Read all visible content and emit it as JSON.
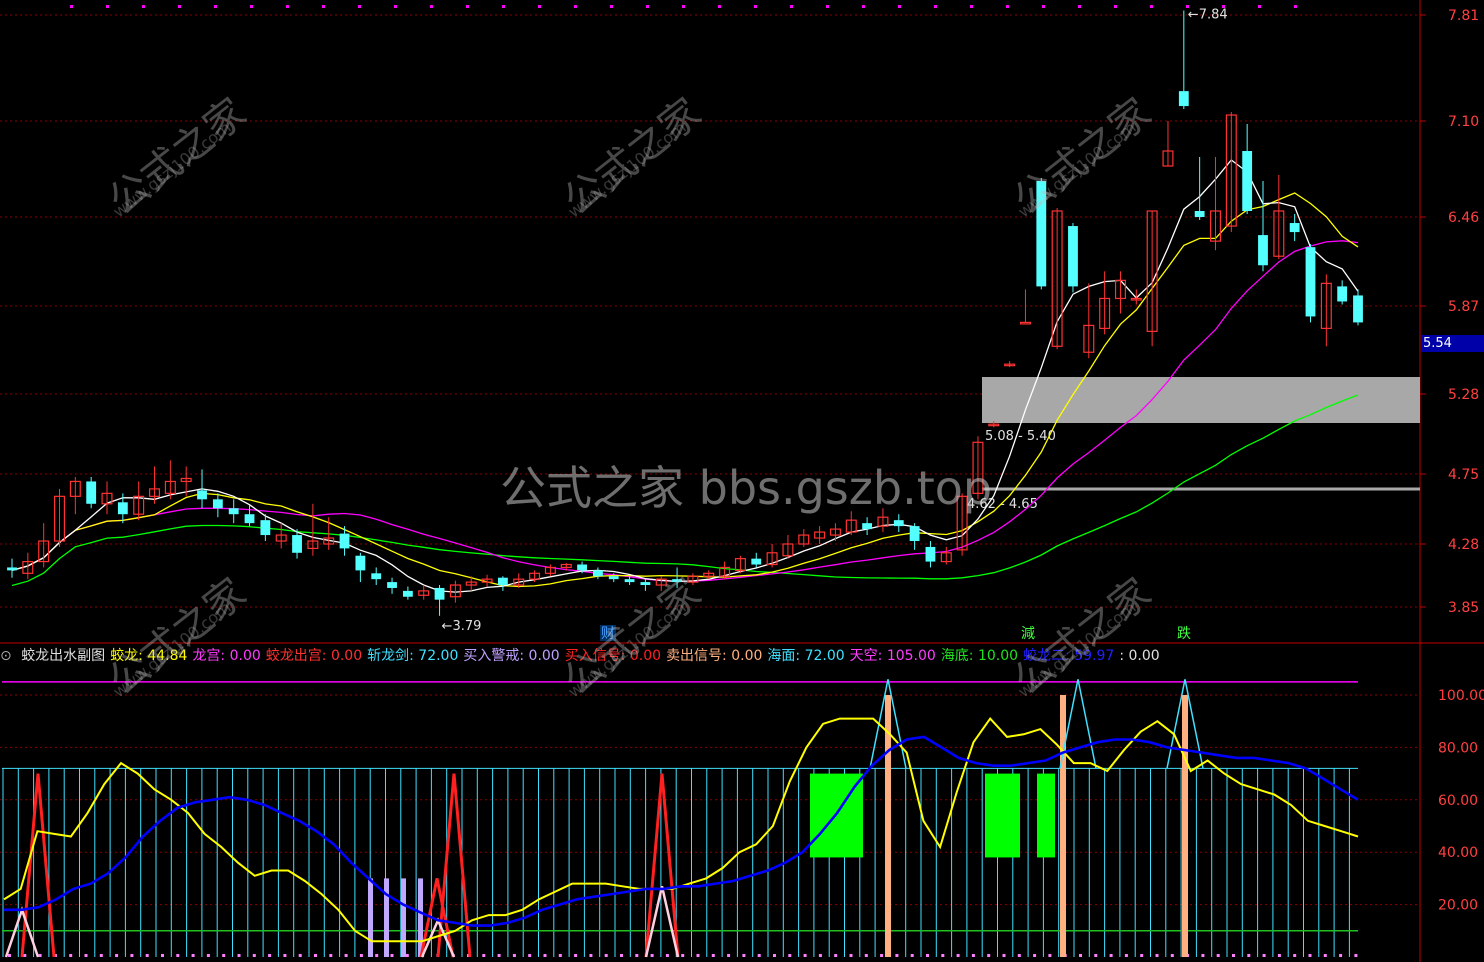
{
  "price_axis": {
    "ticks": [
      "7.81",
      "7.10",
      "6.46",
      "5.87",
      "5.28",
      "4.75",
      "4.28",
      "3.85"
    ],
    "current_price": "5.54"
  },
  "indicator_axis": {
    "ticks": [
      "100.00",
      "80.00",
      "60.00",
      "40.00",
      "20.00"
    ]
  },
  "annotations": {
    "high": "7.84",
    "low": "3.79",
    "zone_upper": "5.08 - 5.40",
    "zone_lower": "4.62 - 4.65",
    "markers": [
      "财",
      "減",
      "跌"
    ]
  },
  "indicator_legend": [
    {
      "name": "蛟龙出水副图",
      "value": "",
      "color": "#e0e0e0"
    },
    {
      "name": "蛟龙",
      "value": "44.84",
      "color": "#ffff00"
    },
    {
      "name": "龙宫",
      "value": "0.00",
      "color": "#ff3cff"
    },
    {
      "name": "蛟龙出宫",
      "value": "0.00",
      "color": "#ff3030"
    },
    {
      "name": "斩龙剑",
      "value": "72.00",
      "color": "#40e0ff"
    },
    {
      "name": "买入警戒",
      "value": "0.00",
      "color": "#c0a0ff"
    },
    {
      "name": "买入信号",
      "value": "0.00",
      "color": "#ff2020"
    },
    {
      "name": "卖出信号",
      "value": "0.00",
      "color": "#ffb080"
    },
    {
      "name": "海面",
      "value": "72.00",
      "color": "#40e0ff"
    },
    {
      "name": "天空",
      "value": "105.00",
      "color": "#ff3cff"
    },
    {
      "name": "海底",
      "value": "10.00",
      "color": "#20e020"
    },
    {
      "name": "蛟龙二",
      "value": "59.97",
      "color": "#2020ff"
    },
    {
      "name": "",
      "value": "0.00",
      "color": "#e0e0e0"
    }
  ],
  "watermarks": {
    "cn": "公式之家",
    "url": "www.gszj100.com",
    "main": "公式之家 bbs.gszb.top"
  },
  "colors": {
    "up": "#ff3232",
    "down": "#54ffff",
    "ma5": "#ffffff",
    "ma10": "#ffff00",
    "ma20": "#ff00ff",
    "ma60": "#00ff00",
    "grid": "#8b0000",
    "dragon": "#ffff00",
    "dragon2": "#0000ff",
    "sword": "#40e0ff",
    "sea_floor": "#20c020"
  },
  "chart_data": [
    {
      "type": "candlestick",
      "title": "",
      "yticks": [
        7.81,
        7.1,
        6.46,
        5.87,
        5.28,
        4.75,
        4.28,
        3.85
      ],
      "candles": [
        [
          4.12,
          4.1,
          4.18,
          4.05
        ],
        [
          4.08,
          4.16,
          4.22,
          4.04
        ],
        [
          4.16,
          4.3,
          4.42,
          4.12
        ],
        [
          4.3,
          4.6,
          4.65,
          4.26
        ],
        [
          4.6,
          4.7,
          4.73,
          4.48
        ],
        [
          4.7,
          4.55,
          4.73,
          4.52
        ],
        [
          4.55,
          4.62,
          4.7,
          4.48
        ],
        [
          4.56,
          4.48,
          4.62,
          4.42
        ],
        [
          4.48,
          4.6,
          4.7,
          4.44
        ],
        [
          4.6,
          4.65,
          4.8,
          4.55
        ],
        [
          4.62,
          4.7,
          4.84,
          4.58
        ],
        [
          4.7,
          4.72,
          4.8,
          4.6
        ],
        [
          4.64,
          4.58,
          4.78,
          4.52
        ],
        [
          4.58,
          4.52,
          4.62,
          4.46
        ],
        [
          4.52,
          4.48,
          4.58,
          4.42
        ],
        [
          4.48,
          4.42,
          4.54,
          4.4
        ],
        [
          4.44,
          4.34,
          4.48,
          4.3
        ],
        [
          4.3,
          4.34,
          4.42,
          4.25
        ],
        [
          4.34,
          4.22,
          4.38,
          4.18
        ],
        [
          4.25,
          4.3,
          4.55,
          4.2
        ],
        [
          4.28,
          4.32,
          4.46,
          4.24
        ],
        [
          4.35,
          4.25,
          4.4,
          4.2
        ],
        [
          4.2,
          4.1,
          4.22,
          4.02
        ],
        [
          4.08,
          4.04,
          4.12,
          4.0
        ],
        [
          4.02,
          3.98,
          4.05,
          3.94
        ],
        [
          3.96,
          3.92,
          3.99,
          3.9
        ],
        [
          3.93,
          3.96,
          4.0,
          3.9
        ],
        [
          3.98,
          3.9,
          4.0,
          3.79
        ],
        [
          3.92,
          4.0,
          4.03,
          3.88
        ],
        [
          4.0,
          4.02,
          4.06,
          3.96
        ],
        [
          4.02,
          4.04,
          4.07,
          3.99
        ],
        [
          4.05,
          4.0,
          4.06,
          3.96
        ],
        [
          4.0,
          4.04,
          4.08,
          3.98
        ],
        [
          4.04,
          4.08,
          4.1,
          4.02
        ],
        [
          4.08,
          4.12,
          4.14,
          4.06
        ],
        [
          4.12,
          4.14,
          4.15,
          4.1
        ],
        [
          4.14,
          4.1,
          4.16,
          4.08
        ],
        [
          4.1,
          4.06,
          4.12,
          4.04
        ],
        [
          4.06,
          4.04,
          4.08,
          4.02
        ],
        [
          4.04,
          4.02,
          4.06,
          4.0
        ],
        [
          4.02,
          4.0,
          4.04,
          3.96
        ],
        [
          4.0,
          4.04,
          4.06,
          3.96
        ],
        [
          4.04,
          4.02,
          4.12,
          3.98
        ],
        [
          4.02,
          4.06,
          4.08,
          4.0
        ],
        [
          4.06,
          4.08,
          4.1,
          4.04
        ],
        [
          4.06,
          4.12,
          4.16,
          4.04
        ],
        [
          4.1,
          4.18,
          4.2,
          4.08
        ],
        [
          4.18,
          4.14,
          4.22,
          4.12
        ],
        [
          4.14,
          4.22,
          4.28,
          4.12
        ],
        [
          4.2,
          4.28,
          4.34,
          4.18
        ],
        [
          4.28,
          4.34,
          4.38,
          4.26
        ],
        [
          4.32,
          4.36,
          4.4,
          4.28
        ],
        [
          4.34,
          4.38,
          4.42,
          4.3
        ],
        [
          4.36,
          4.44,
          4.5,
          4.34
        ],
        [
          4.42,
          4.38,
          4.46,
          4.34
        ],
        [
          4.4,
          4.46,
          4.52,
          4.36
        ],
        [
          4.44,
          4.4,
          4.48,
          4.36
        ],
        [
          4.4,
          4.3,
          4.42,
          4.24
        ],
        [
          4.26,
          4.16,
          4.3,
          4.12
        ],
        [
          4.16,
          4.22,
          4.26,
          4.14
        ],
        [
          4.24,
          4.6,
          4.62,
          4.2
        ],
        [
          4.62,
          4.96,
          5.0,
          4.58
        ],
        [
          5.08,
          5.08,
          5.1,
          5.06
        ],
        [
          5.48,
          5.48,
          5.5,
          5.46
        ],
        [
          5.76,
          5.76,
          5.98,
          5.76
        ],
        [
          6.7,
          6.0,
          6.72,
          5.98
        ],
        [
          5.6,
          6.5,
          6.52,
          5.58
        ],
        [
          6.4,
          6.0,
          6.42,
          5.96
        ],
        [
          5.56,
          5.74,
          6.02,
          5.52
        ],
        [
          5.72,
          5.92,
          6.1,
          5.68
        ],
        [
          5.92,
          6.04,
          6.1,
          5.82
        ],
        [
          5.92,
          5.92,
          5.98,
          5.88
        ],
        [
          5.7,
          6.5,
          6.5,
          5.6
        ],
        [
          6.8,
          6.9,
          7.1,
          6.8
        ],
        [
          7.3,
          7.2,
          7.84,
          7.18
        ],
        [
          6.5,
          6.46,
          6.86,
          6.44
        ],
        [
          6.3,
          6.5,
          6.86,
          6.24
        ],
        [
          6.4,
          7.14,
          7.16,
          6.36
        ],
        [
          6.9,
          6.5,
          7.08,
          6.48
        ],
        [
          6.34,
          6.14,
          6.7,
          6.1
        ],
        [
          6.2,
          6.5,
          6.74,
          6.18
        ],
        [
          6.42,
          6.36,
          6.48,
          6.3
        ],
        [
          6.26,
          5.8,
          6.28,
          5.76
        ],
        [
          5.72,
          6.02,
          6.08,
          5.6
        ],
        [
          6.0,
          5.9,
          6.04,
          5.88
        ],
        [
          5.94,
          5.76,
          5.98,
          5.74
        ]
      ]
    },
    {
      "type": "line",
      "title": "蛟龙出水副图",
      "yticks": [
        100,
        80,
        60,
        40,
        20
      ],
      "series": [
        {
          "name": "蛟龙",
          "values": [
            22,
            26,
            48,
            47,
            46,
            55,
            66,
            74,
            70,
            64,
            60,
            55,
            47,
            42,
            36,
            31,
            33,
            33,
            29,
            24,
            18,
            10,
            6,
            6,
            6,
            6,
            8,
            10,
            14,
            16,
            16,
            18,
            22,
            25,
            28,
            28,
            28,
            27,
            26,
            26,
            26,
            28,
            30,
            34,
            40,
            43,
            50,
            67,
            80,
            89,
            91,
            91,
            91,
            85,
            78,
            52,
            42,
            63,
            82,
            91,
            84,
            85,
            87,
            81,
            74,
            74,
            71,
            79,
            86,
            90,
            85,
            71,
            75,
            70,
            66,
            64,
            62,
            58,
            52,
            50,
            48,
            46
          ]
        },
        {
          "name": "蛟龙二",
          "values": [
            18,
            18,
            19,
            22,
            26,
            28,
            32,
            38,
            46,
            52,
            57,
            59,
            60,
            61,
            60,
            58,
            55,
            52,
            48,
            43,
            36,
            30,
            24,
            20,
            17,
            14,
            13,
            12,
            12,
            13,
            15,
            18,
            20,
            22,
            23,
            24,
            25,
            26,
            26,
            27,
            27,
            28,
            29,
            31,
            33,
            36,
            40,
            47,
            55,
            65,
            73,
            79,
            83,
            84,
            80,
            76,
            74,
            73,
            73,
            74,
            75,
            78,
            80,
            82,
            83,
            83,
            82,
            80,
            79,
            78,
            77,
            76,
            76,
            75,
            74,
            72,
            68,
            64,
            60
          ]
        },
        {
          "name": "斩龙剑",
          "constant": 72
        },
        {
          "name": "海底",
          "constant": 10
        },
        {
          "name": "天空",
          "constant": 105
        }
      ]
    }
  ]
}
